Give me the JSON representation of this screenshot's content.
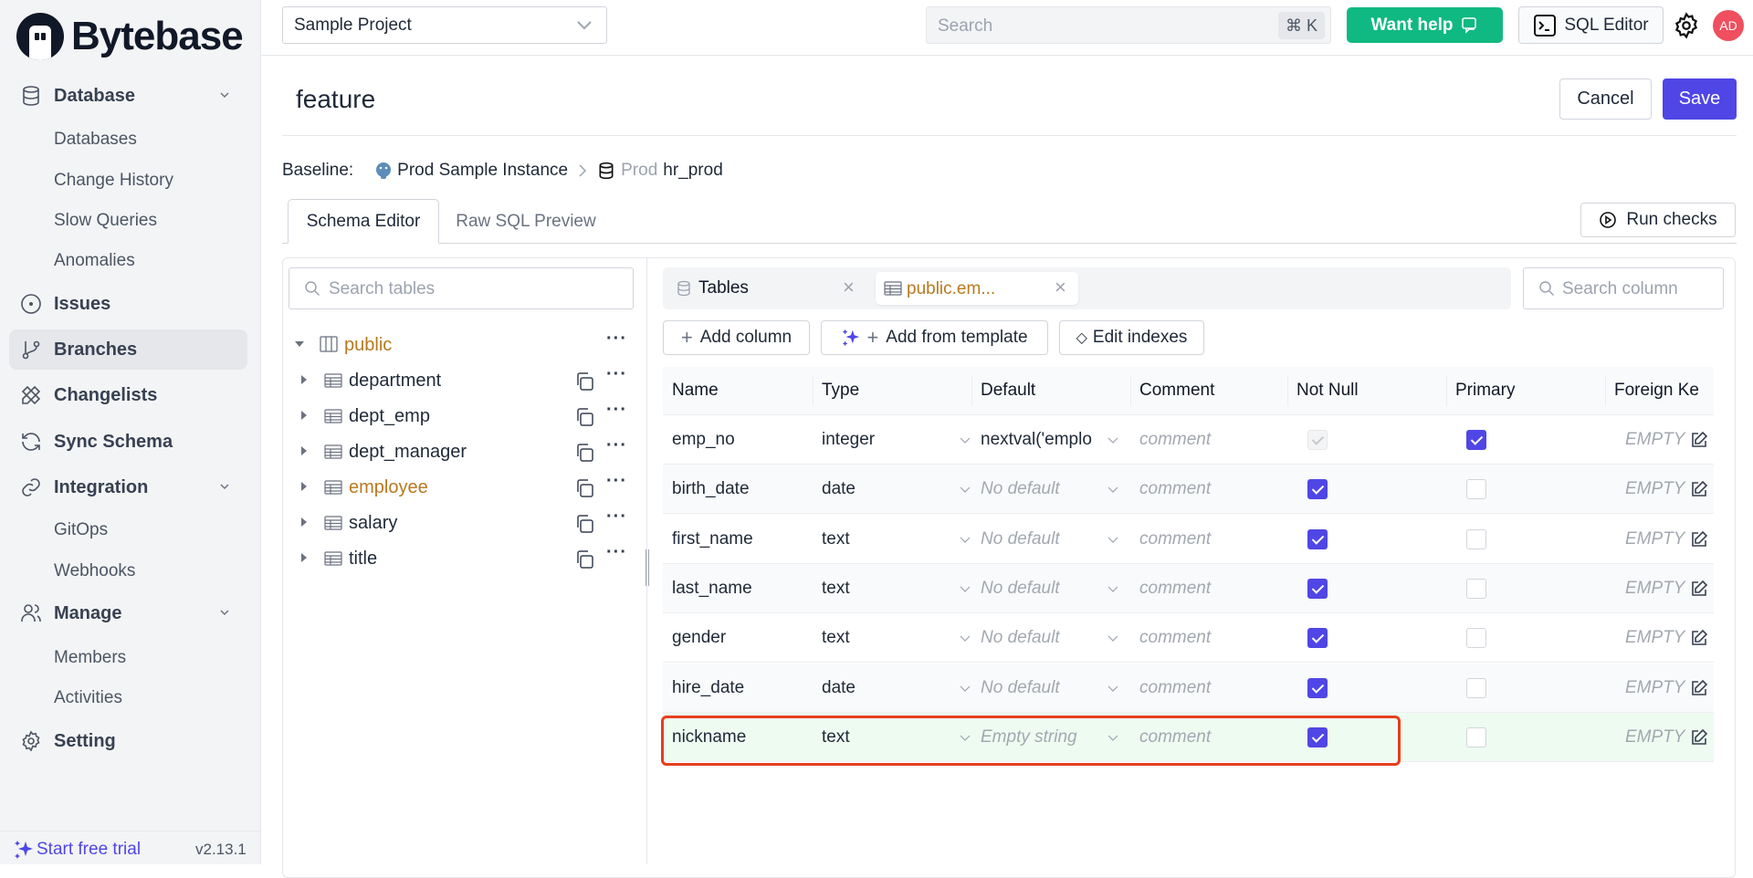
{
  "brand": {
    "name": "Bytebase"
  },
  "sidebar": {
    "sections": [
      {
        "label": "Database",
        "icon": "database-icon",
        "expandable": true,
        "children": [
          "Databases",
          "Change History",
          "Slow Queries",
          "Anomalies"
        ]
      },
      {
        "label": "Issues",
        "icon": "circle-dot-icon"
      },
      {
        "label": "Branches",
        "icon": "git-branch-icon",
        "active": true
      },
      {
        "label": "Changelists",
        "icon": "pencil-ruler-icon"
      },
      {
        "label": "Sync Schema",
        "icon": "refresh-icon"
      },
      {
        "label": "Integration",
        "icon": "link-icon",
        "expandable": true,
        "children": [
          "GitOps",
          "Webhooks"
        ]
      },
      {
        "label": "Manage",
        "icon": "users-icon",
        "expandable": true,
        "children": [
          "Members",
          "Activities"
        ]
      },
      {
        "label": "Setting",
        "icon": "gear-icon"
      }
    ],
    "footer": {
      "trial_label": "Start free trial",
      "version": "v2.13.1"
    }
  },
  "header": {
    "project": "Sample Project",
    "search_placeholder": "Search",
    "search_shortcut": "⌘ K",
    "help_label": "Want help",
    "sql_editor_label": "SQL Editor",
    "avatar_initials": "AD"
  },
  "page": {
    "title": "feature",
    "cancel_label": "Cancel",
    "save_label": "Save",
    "baseline_label": "Baseline:",
    "instance": "Prod Sample Instance",
    "env": "Prod",
    "database": "hr_prod",
    "tabs": [
      "Schema Editor",
      "Raw SQL Preview"
    ],
    "active_tab": "Schema Editor",
    "run_checks_label": "Run checks"
  },
  "tree": {
    "search_placeholder": "Search tables",
    "schema": "public",
    "tables": [
      {
        "name": "department",
        "highlight": false
      },
      {
        "name": "dept_emp",
        "highlight": false
      },
      {
        "name": "dept_manager",
        "highlight": false
      },
      {
        "name": "employee",
        "highlight": true
      },
      {
        "name": "salary",
        "highlight": false
      },
      {
        "name": "title",
        "highlight": false
      }
    ]
  },
  "editor": {
    "tabs": [
      {
        "label": "Tables",
        "icon": "database-icon"
      },
      {
        "label": "public.em...",
        "icon": "table-icon",
        "active": true
      }
    ],
    "search_column_placeholder": "Search column",
    "actions": {
      "add_column": "Add column",
      "add_from_template": "Add from template",
      "edit_indexes": "Edit indexes"
    },
    "columns": [
      "Name",
      "Type",
      "Default",
      "Comment",
      "Not Null",
      "Primary",
      "Foreign Ke"
    ],
    "rows": [
      {
        "name": "emp_no",
        "type": "integer",
        "default": "nextval('emplo",
        "default_placeholder": false,
        "comment": "comment",
        "not_null": true,
        "not_null_disabled": true,
        "primary": true,
        "fk": "EMPTY"
      },
      {
        "name": "birth_date",
        "type": "date",
        "default": "No default",
        "default_placeholder": true,
        "comment": "comment",
        "not_null": true,
        "primary": false,
        "fk": "EMPTY"
      },
      {
        "name": "first_name",
        "type": "text",
        "default": "No default",
        "default_placeholder": true,
        "comment": "comment",
        "not_null": true,
        "primary": false,
        "fk": "EMPTY"
      },
      {
        "name": "last_name",
        "type": "text",
        "default": "No default",
        "default_placeholder": true,
        "comment": "comment",
        "not_null": true,
        "primary": false,
        "fk": "EMPTY"
      },
      {
        "name": "gender",
        "type": "text",
        "default": "No default",
        "default_placeholder": true,
        "comment": "comment",
        "not_null": true,
        "primary": false,
        "fk": "EMPTY"
      },
      {
        "name": "hire_date",
        "type": "date",
        "default": "No default",
        "default_placeholder": true,
        "comment": "comment",
        "not_null": true,
        "primary": false,
        "fk": "EMPTY"
      },
      {
        "name": "nickname",
        "type": "text",
        "default": "Empty string",
        "default_placeholder": true,
        "comment": "comment",
        "not_null": true,
        "primary": false,
        "fk": "EMPTY",
        "is_new": true
      }
    ]
  },
  "colors": {
    "accent": "#4f46e5",
    "help_green": "#10b981",
    "highlight_orange": "#b7791f",
    "new_row_bg": "#eefbf1",
    "annotation_red": "#e53e1e"
  }
}
